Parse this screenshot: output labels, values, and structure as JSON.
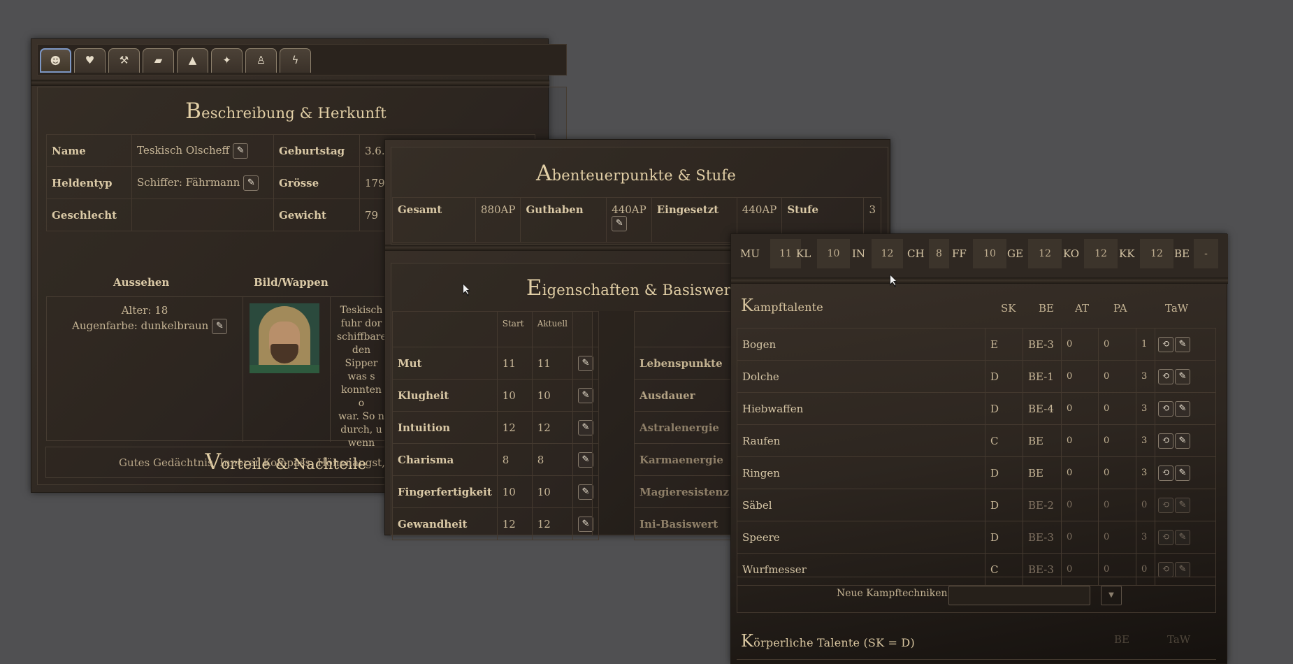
{
  "hero_panel": {
    "tabs": [
      {
        "icon": "person-icon"
      },
      {
        "icon": "heart-icon"
      },
      {
        "icon": "hammer-icon"
      },
      {
        "icon": "bag-icon"
      },
      {
        "icon": "graduation-cap-icon"
      },
      {
        "icon": "magic-wand-icon"
      },
      {
        "icon": "idol-icon"
      },
      {
        "icon": "lightning-icon"
      }
    ],
    "section_title": {
      "cap": "B",
      "rest": "eschreibung & Herkunft"
    },
    "fields": [
      {
        "label": "Name",
        "value": "Teskisch Olscheff",
        "label2": "Geburtstag",
        "value2": "3.6."
      },
      {
        "label": "Heldentyp",
        "value": "Schiffer: Fährmann",
        "label2": "Grösse",
        "value2": "179"
      },
      {
        "label": "Geschlecht",
        "value": "",
        "label2": "Gewicht",
        "value2": "79"
      }
    ],
    "aussehen_header": "Aussehen",
    "bild_header": "Bild/Wappen",
    "alter": "Alter: 18",
    "augenfarbe": "Augenfarbe: dunkelbraun",
    "story_lines": [
      "Teskisch",
      "fuhr dor",
      "schiffbare",
      "den Sipper",
      "was s",
      "konnten o",
      "war. So n",
      "durch, u",
      "wenn"
    ],
    "vorteile_title": {
      "cap": "V",
      "rest": "orteile & Nachteile"
    },
    "vorteile_text": "Gutes Gedächtnis, Innerer Kompass, Höhenangst, Neug"
  },
  "ap_panel": {
    "title": {
      "cap": "A",
      "rest": "benteuerpunkte & Stufe"
    },
    "row": {
      "gesamt_label": "Gesamt",
      "gesamt": "880AP",
      "guthaben_label": "Guthaben",
      "guthaben": "440AP",
      "eingesetzt_label": "Eingesetzt",
      "eingesetzt": "440AP",
      "stufe_label": "Stufe",
      "stufe": "3"
    },
    "eig_title": {
      "cap": "E",
      "rest": "igenschaften & Basiswerte"
    },
    "col_start": "Start",
    "col_aktuell": "Aktuell",
    "attributes": [
      {
        "name": "Mut",
        "start": "11",
        "aktuell": "11",
        "base": "Lebenspunkte"
      },
      {
        "name": "Klugheit",
        "start": "10",
        "aktuell": "10",
        "base": "Ausdauer"
      },
      {
        "name": "Intuition",
        "start": "12",
        "aktuell": "12",
        "base": "Astralenergie"
      },
      {
        "name": "Charisma",
        "start": "8",
        "aktuell": "8",
        "base": "Karmaenergie"
      },
      {
        "name": "Fingerfertigkeit",
        "start": "10",
        "aktuell": "10",
        "base": "Magieresistenz"
      },
      {
        "name": "Gewandheit",
        "start": "12",
        "aktuell": "12",
        "base": "Ini-Basiswert"
      }
    ]
  },
  "talent_panel": {
    "attr_bar": [
      {
        "k": "MU",
        "v": "11"
      },
      {
        "k": "KL",
        "v": "10"
      },
      {
        "k": "IN",
        "v": "12"
      },
      {
        "k": "CH",
        "v": "8"
      },
      {
        "k": "FF",
        "v": "10"
      },
      {
        "k": "GE",
        "v": "12"
      },
      {
        "k": "KO",
        "v": "12"
      },
      {
        "k": "KK",
        "v": "12"
      },
      {
        "k": "BE",
        "v": "-"
      }
    ],
    "kampf_title": {
      "cap": "K",
      "rest": "ampftalente"
    },
    "headers": {
      "sk": "SK",
      "be": "BE",
      "at": "AT",
      "pa": "PA",
      "taw": "TaW"
    },
    "talents": [
      {
        "name": "Bogen",
        "sk": "E",
        "be": "BE-3",
        "at": "0",
        "pa": "0",
        "taw": "1",
        "dim": false
      },
      {
        "name": "Dolche",
        "sk": "D",
        "be": "BE-1",
        "at": "0",
        "pa": "0",
        "taw": "3",
        "dim": false
      },
      {
        "name": "Hiebwaffen",
        "sk": "D",
        "be": "BE-4",
        "at": "0",
        "pa": "0",
        "taw": "3",
        "dim": false
      },
      {
        "name": "Raufen",
        "sk": "C",
        "be": "BE",
        "at": "0",
        "pa": "0",
        "taw": "3",
        "dim": false
      },
      {
        "name": "Ringen",
        "sk": "D",
        "be": "BE",
        "at": "0",
        "pa": "0",
        "taw": "3",
        "dim": false
      },
      {
        "name": "Säbel",
        "sk": "D",
        "be": "BE-2",
        "at": "0",
        "pa": "0",
        "taw": "0",
        "dim": true
      },
      {
        "name": "Speere",
        "sk": "D",
        "be": "BE-3",
        "at": "0",
        "pa": "0",
        "taw": "3",
        "dim": true
      },
      {
        "name": "Wurfmesser",
        "sk": "C",
        "be": "BE-3",
        "at": "0",
        "pa": "0",
        "taw": "0",
        "dim": true
      }
    ],
    "neue_label": "Neue Kampftechniken:",
    "koerper_title": {
      "cap": "K",
      "rest": "örperliche Talente (SK = D)"
    },
    "koerper_be": "BE",
    "koerper_taw": "TaW"
  }
}
